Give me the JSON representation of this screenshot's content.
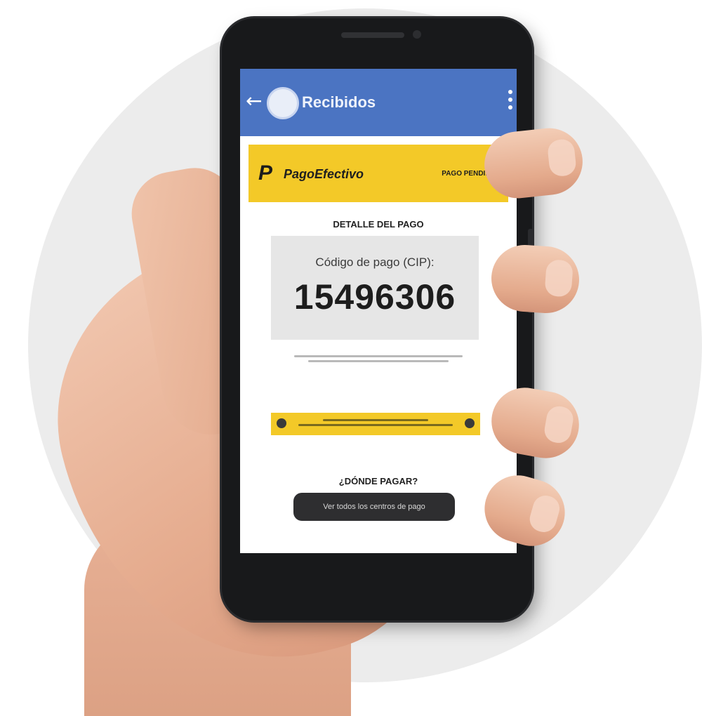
{
  "header": {
    "title": "Recibidos"
  },
  "brand": {
    "logo_mark": "P",
    "name": "PagoEfectivo",
    "status": "PAGO PENDIENTE"
  },
  "detail": {
    "section_title": "DETALLE DEL PAGO",
    "code_label": "Código de pago (CIP):",
    "code_value": "15496306"
  },
  "where": {
    "section_title": "¿DÓNDE PAGAR?",
    "button_label": "Ver todos los centros de pago"
  },
  "icons": {
    "back": "arrow-left-icon",
    "avatar": "avatar",
    "menu": "more-vertical-icon",
    "info": "info-icon"
  },
  "colors": {
    "appbar": "#4b74c2",
    "brand_yellow": "#f3c928",
    "code_card": "#e6e6e6",
    "button": "#2e2e30"
  }
}
